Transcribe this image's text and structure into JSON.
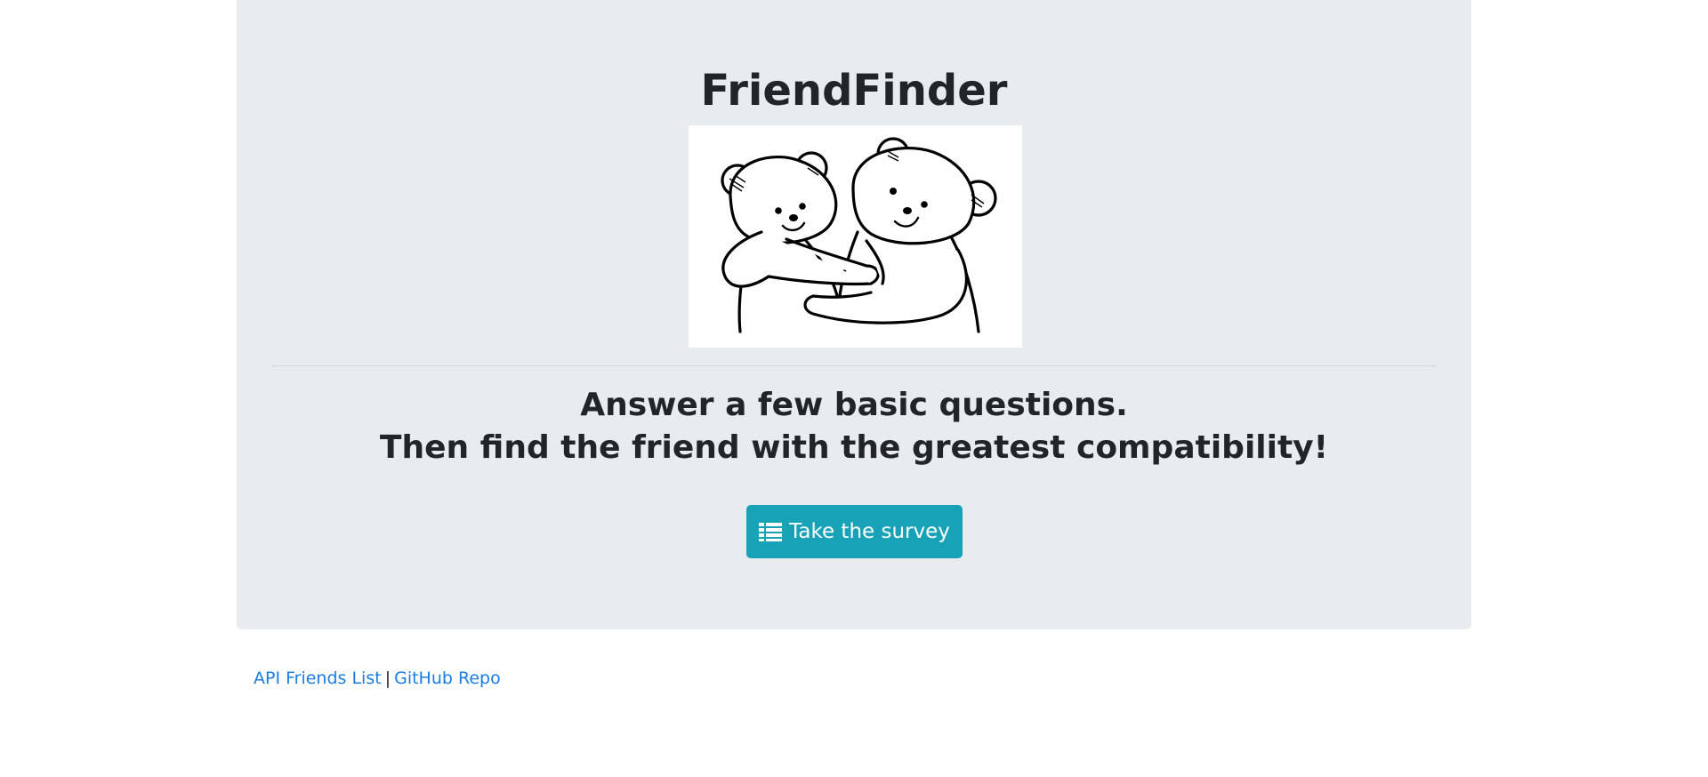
{
  "header": {
    "title": "FriendFinder"
  },
  "hero": {
    "image_alt": "two teddy bears hugging",
    "tagline_line1": "Answer a few basic questions.",
    "tagline_line2": "Then find the friend with the greatest compatibility!"
  },
  "survey_button": {
    "label": "Take the survey",
    "icon": "list-icon",
    "color": "#17a2b8"
  },
  "footer": {
    "link_api": "API Friends List",
    "separator": "|",
    "link_github": "GitHub Repo",
    "link_color": "#1a7de6"
  },
  "colors": {
    "jumbotron_bg": "#e9ecef",
    "text": "#212529"
  }
}
